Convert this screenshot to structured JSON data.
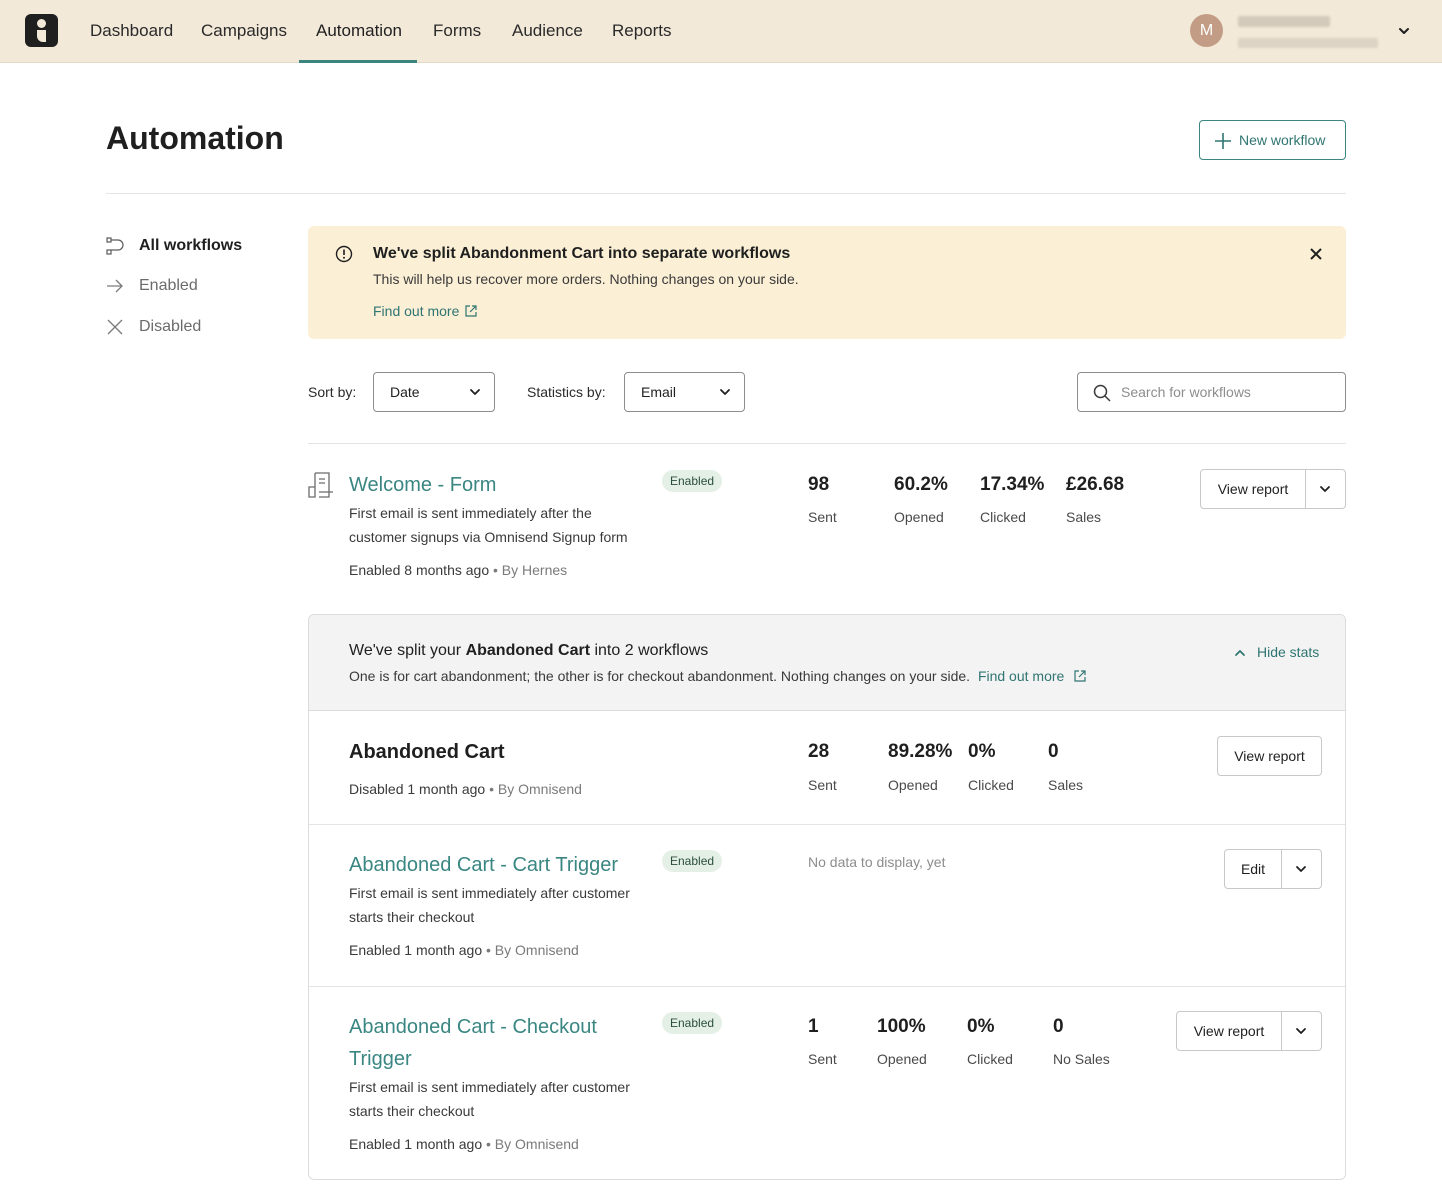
{
  "nav": {
    "items": [
      "Dashboard",
      "Campaigns",
      "Automation",
      "Forms",
      "Audience",
      "Reports"
    ],
    "active": "Automation",
    "avatar_initial": "M"
  },
  "header": {
    "title": "Automation",
    "new_workflow": "New workflow"
  },
  "sidebar": {
    "items": [
      {
        "label": "All workflows",
        "icon": "workflow-icon"
      },
      {
        "label": "Enabled",
        "icon": "arrow-right-icon"
      },
      {
        "label": "Disabled",
        "icon": "x-icon"
      }
    ]
  },
  "notice": {
    "title": "We've split Abandonment Cart into separate workflows",
    "text": "This will help us recover more orders. Nothing changes on your side.",
    "link": "Find out more"
  },
  "filters": {
    "sort_label": "Sort by:",
    "sort_value": "Date",
    "stats_label": "Statistics by:",
    "stats_value": "Email",
    "search_placeholder": "Search for workflows"
  },
  "welcome": {
    "name": "Welcome - Form",
    "badge": "Enabled",
    "desc1": "First email is sent immediately after the",
    "desc2": "customer signups via Omnisend Signup form",
    "meta": "Enabled 8 months ago",
    "by": "• By Hernes",
    "stats": [
      {
        "value": "98",
        "label": "Sent"
      },
      {
        "value": "60.2%",
        "label": "Opened"
      },
      {
        "value": "17.34%",
        "label": "Clicked"
      },
      {
        "value": "£26.68",
        "label": "Sales"
      }
    ],
    "button": "View report"
  },
  "group": {
    "title_pre": "We've split your ",
    "title_bold": "Abandoned Cart",
    "title_post": " into 2 workflows",
    "text": "One is for cart abandonment; the other is for checkout abandonment. Nothing changes on your side.",
    "link": "Find out more",
    "hide_stats": "Hide stats",
    "abandoned": {
      "name": "Abandoned Cart",
      "meta": "Disabled 1 month ago",
      "by": "• By Omnisend",
      "stats": [
        {
          "value": "28",
          "label": "Sent"
        },
        {
          "value": "89.28%",
          "label": "Opened"
        },
        {
          "value": "0%",
          "label": "Clicked"
        },
        {
          "value": "0",
          "label": "Sales"
        }
      ],
      "button": "View report"
    },
    "cart_trigger": {
      "name": "Abandoned Cart - Cart Trigger",
      "badge": "Enabled",
      "desc1": "First email is sent immediately after customer",
      "desc2": "starts their checkout",
      "meta": "Enabled 1 month ago",
      "by": "• By Omnisend",
      "no_data": "No data to display, yet",
      "button": "Edit"
    },
    "checkout_trigger": {
      "name1": "Abandoned Cart - Checkout",
      "name2": "Trigger",
      "badge": "Enabled",
      "desc1": "First email is sent immediately after customer",
      "desc2": "starts their checkout",
      "meta": "Enabled 1 month ago",
      "by": "• By Omnisend",
      "stats": [
        {
          "value": "1",
          "label": "Sent"
        },
        {
          "value": "100%",
          "label": "Opened"
        },
        {
          "value": "0%",
          "label": "Clicked"
        },
        {
          "value": "0",
          "label": "No Sales"
        }
      ],
      "button": "View report"
    }
  },
  "colors": {
    "topbar": "#f2e9d9",
    "accent": "#3b8480",
    "notice_bg": "#fbefd6",
    "badge_bg": "#e4efe6"
  }
}
